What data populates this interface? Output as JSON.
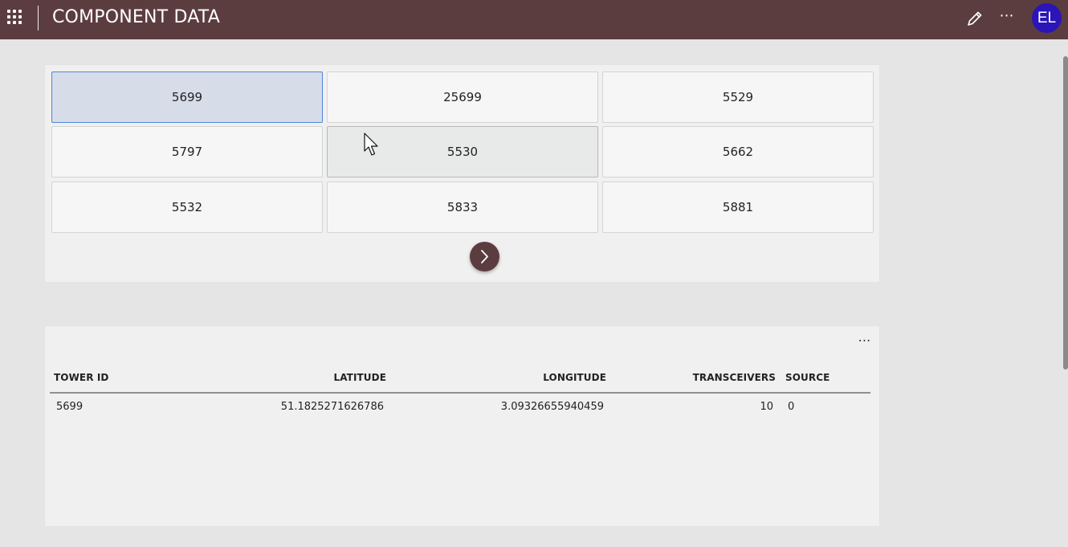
{
  "header": {
    "title": "COMPONENT DATA",
    "avatar_initials": "EL",
    "more_label": "⋯",
    "bg_color": "#5c3d3f",
    "avatar_color": "#2b14b8"
  },
  "gallery": {
    "tiles": [
      "5699",
      "25699",
      "5529",
      "5797",
      "5530",
      "5662",
      "5532",
      "5833",
      "5881"
    ],
    "selected": "5699",
    "hovered": "5530"
  },
  "table": {
    "more_label": "⋯",
    "columns": [
      "TOWER ID",
      "LATITUDE",
      "LONGITUDE",
      "TRANSCEIVERS",
      "SOURCE"
    ],
    "rows": [
      [
        "5699",
        "51.1825271626786",
        "3.09326655940459",
        "10",
        "0"
      ]
    ]
  }
}
